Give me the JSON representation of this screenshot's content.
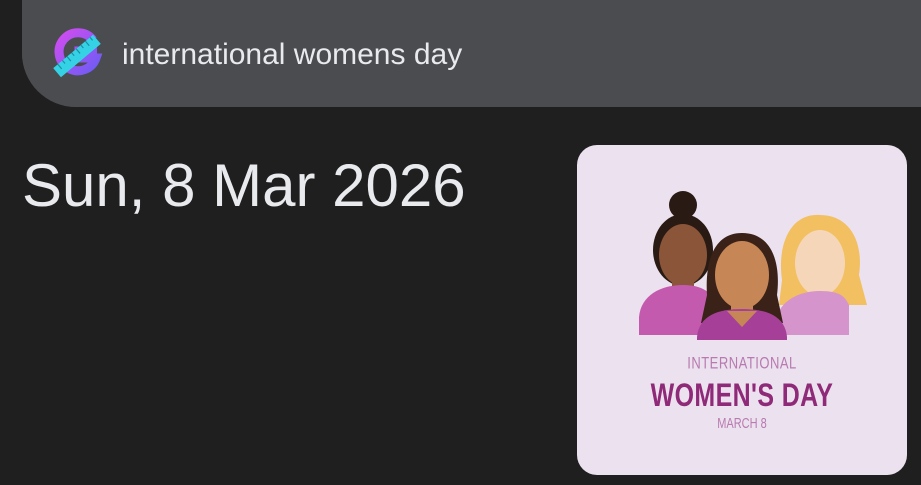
{
  "search": {
    "query": "international womens day",
    "logo_icon": "google-lens-logo-icon"
  },
  "result": {
    "date": "Sun, 8 Mar 2026"
  },
  "card": {
    "line1": "INTERNATIONAL",
    "line2": "WOMEN'S DAY",
    "line3": "MARCH 8",
    "background": "#ece1ef",
    "accent": "#8f2a78"
  },
  "colors": {
    "page_bg": "#1f1f1f",
    "bar_bg": "#4a4c50",
    "text": "#e8eaed"
  }
}
